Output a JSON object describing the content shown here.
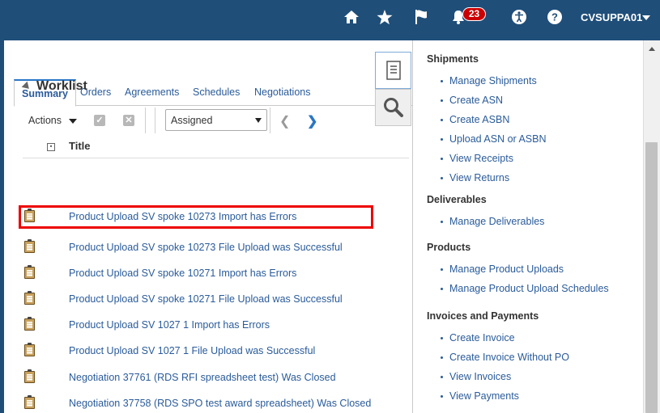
{
  "header": {
    "notification_count": "23",
    "user_label": "CVSUPPA01",
    "icons": [
      "home-icon",
      "star-icon",
      "flag-icon",
      "bell-icon",
      "accessibility-icon",
      "help-icon"
    ]
  },
  "tabs": [
    {
      "label": "Summary",
      "active": true
    },
    {
      "label": "Orders"
    },
    {
      "label": "Agreements"
    },
    {
      "label": "Schedules"
    },
    {
      "label": "Negotiations"
    }
  ],
  "worklist": {
    "title": "Worklist",
    "actions_label": "Actions",
    "filter_value": "Assigned",
    "column_title": "Title",
    "rows": [
      "Product Upload SV  spoke 10273 Import has Errors",
      "Product Upload SV  spoke 10273 File Upload was Successful",
      "Product Upload SV  spoke 10271 Import has Errors",
      "Product Upload SV  spoke 10271 File Upload was Successful",
      "Product Upload SV  1027 1 Import has Errors",
      "Product Upload SV  1027 1 File Upload was Successful",
      "Negotiation 37761 (RDS RFI spreadsheet test) Was Closed",
      "Negotiation 37758 (RDS SPO test award spreadsheet) Was Closed"
    ]
  },
  "right_panel": {
    "sections": [
      {
        "title": "Shipments",
        "links": [
          "Manage Shipments",
          "Create ASN",
          "Create ASBN",
          "Upload ASN or ASBN",
          "View Receipts",
          "View Returns"
        ]
      },
      {
        "title": "Deliverables",
        "links": [
          "Manage Deliverables"
        ]
      },
      {
        "title": "Products",
        "links": [
          "Manage Product Uploads",
          "Manage Product Upload Schedules"
        ]
      },
      {
        "title": "Invoices and Payments",
        "links": [
          "Create Invoice",
          "Create Invoice Without PO",
          "View Invoices",
          "View Payments"
        ]
      }
    ]
  },
  "colors": {
    "header_bg": "#1f4e79",
    "link": "#2a5b9a",
    "highlight": "#e00000",
    "badge": "#cc0000"
  }
}
